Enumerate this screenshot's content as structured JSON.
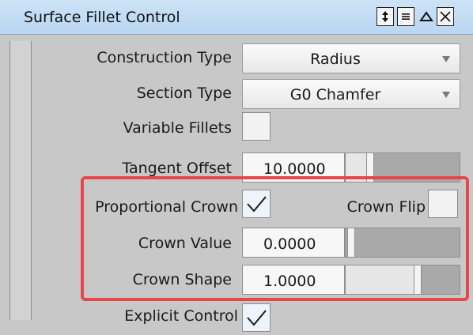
{
  "window": {
    "title": "Surface Fillet Control",
    "icons": [
      "resize-icon",
      "menu-icon",
      "collapse-icon",
      "close-icon"
    ]
  },
  "construction_type": {
    "label": "Construction Type",
    "value": "Radius"
  },
  "section_type": {
    "label": "Section Type",
    "value": "G0 Chamfer"
  },
  "variable_fillets": {
    "label": "Variable Fillets",
    "checked": false
  },
  "tangent_offset": {
    "label": "Tangent Offset",
    "value": "10.0000",
    "slider_fraction": 0.24
  },
  "proportional_crown": {
    "label": "Proportional Crown",
    "checked": true
  },
  "crown_flip": {
    "label": "Crown Flip",
    "checked": false
  },
  "crown_value": {
    "label": "Crown Value",
    "value": "0.0000",
    "slider_fraction": 0.0
  },
  "crown_shape": {
    "label": "Crown Shape",
    "value": "1.0000",
    "slider_fraction": 0.62
  },
  "explicit_control": {
    "label": "Explicit Control",
    "checked": true
  },
  "colors": {
    "highlight": "#e8474a",
    "titlebar": "#c3dcf4",
    "panel": "#c8c8c8"
  }
}
